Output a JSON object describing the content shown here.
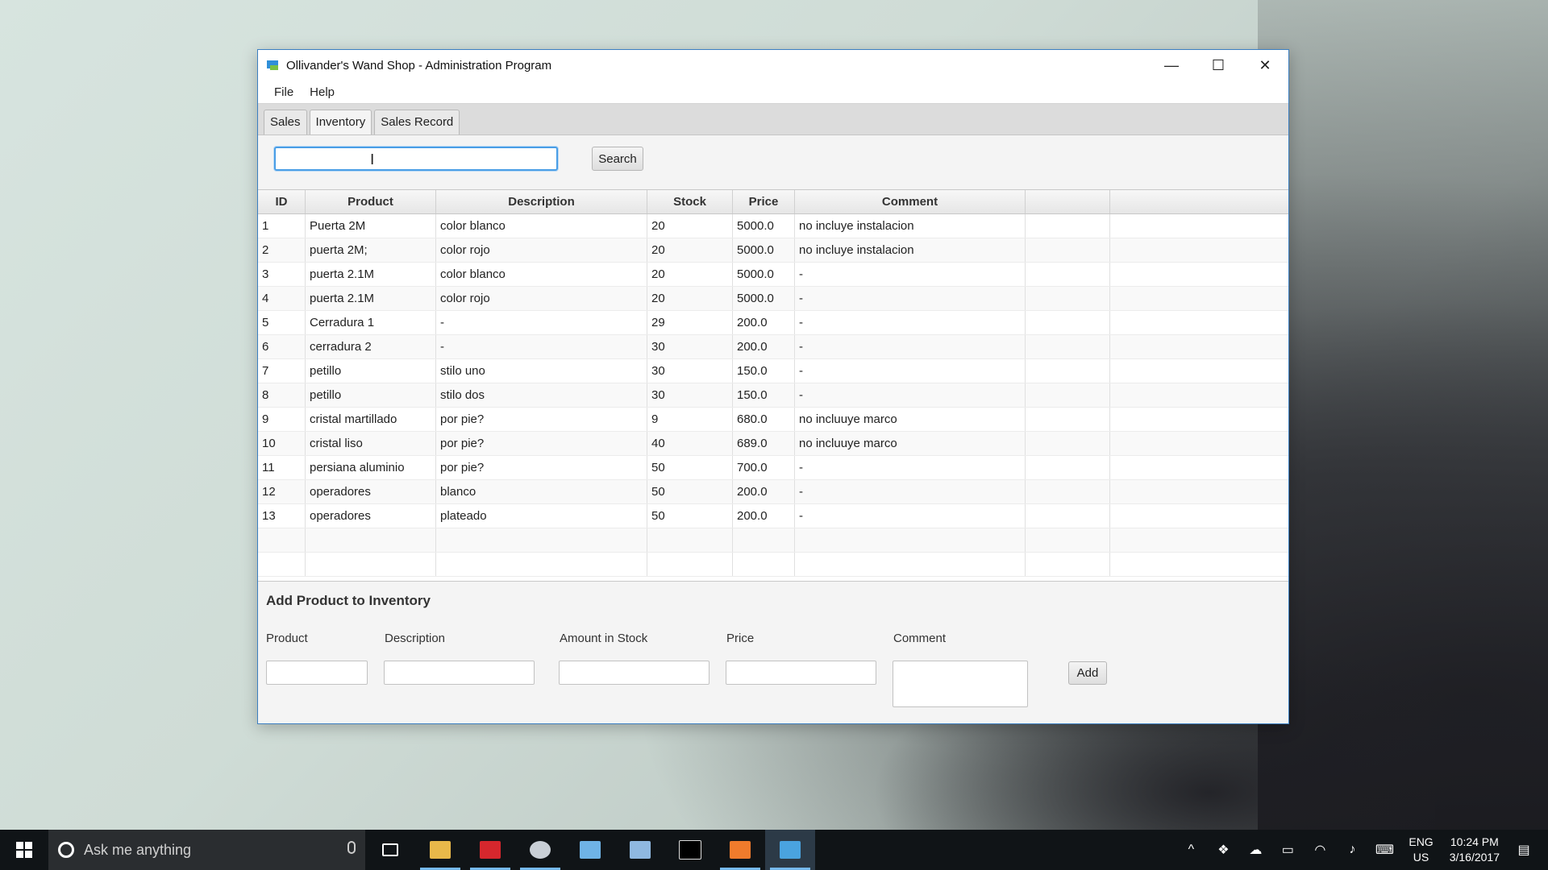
{
  "window": {
    "title": "Ollivander's Wand Shop - Administration Program",
    "controls": {
      "minimize": "—",
      "maximize": "☐",
      "close": "✕"
    }
  },
  "menu": [
    "File",
    "Help"
  ],
  "tabs": [
    {
      "label": "Sales",
      "active": false
    },
    {
      "label": "Inventory",
      "active": true
    },
    {
      "label": "Sales Record",
      "active": false
    }
  ],
  "search": {
    "value": "",
    "button_label": "Search"
  },
  "table": {
    "columns": [
      "ID",
      "Product",
      "Description",
      "Stock",
      "Price",
      "Comment",
      "",
      ""
    ],
    "rows": [
      [
        "1",
        "Puerta 2M",
        "color blanco",
        "20",
        "5000.0",
        "no incluye instalacion"
      ],
      [
        "2",
        "puerta 2M;",
        "color rojo",
        "20",
        "5000.0",
        "no incluye instalacion"
      ],
      [
        "3",
        "puerta 2.1M",
        "color blanco",
        "20",
        "5000.0",
        "-"
      ],
      [
        "4",
        "puerta 2.1M",
        "color rojo",
        "20",
        "5000.0",
        "-"
      ],
      [
        "5",
        "Cerradura 1",
        "-",
        "29",
        "200.0",
        "-"
      ],
      [
        "6",
        "cerradura 2",
        "-",
        "30",
        "200.0",
        "-"
      ],
      [
        "7",
        "petillo",
        "stilo uno",
        "30",
        "150.0",
        "-"
      ],
      [
        "8",
        "petillo",
        "stilo dos",
        "30",
        "150.0",
        "-"
      ],
      [
        "9",
        "cristal martillado",
        "por pie?",
        "9",
        "680.0",
        "no incluuye marco"
      ],
      [
        "10",
        "cristal liso",
        "por pie?",
        "40",
        "689.0",
        "no incluuye marco"
      ],
      [
        "11",
        "persiana aluminio",
        "por pie?",
        "50",
        "700.0",
        "-"
      ],
      [
        "12",
        "operadores",
        "blanco",
        "50",
        "200.0",
        "-"
      ],
      [
        "13",
        "operadores",
        "plateado",
        "50",
        "200.0",
        "-"
      ]
    ]
  },
  "add_form": {
    "title": "Add Product to Inventory",
    "labels": {
      "product": "Product",
      "description": "Description",
      "stock": "Amount in Stock",
      "price": "Price",
      "comment": "Comment"
    },
    "add_label": "Add"
  },
  "taskbar": {
    "search_placeholder": "Ask me anything",
    "apps": [
      "file-explorer",
      "vivaldi",
      "snipping-tool",
      "notepad-app",
      "3d-app",
      "terminal",
      "orange-app",
      "wand-shop-app"
    ],
    "lang": [
      "ENG",
      "US"
    ],
    "time": "10:24 PM",
    "date": "3/16/2017"
  },
  "colors": {
    "accent": "#3c7fc1",
    "focus": "#4a9ee6",
    "taskbar": "#101417"
  }
}
